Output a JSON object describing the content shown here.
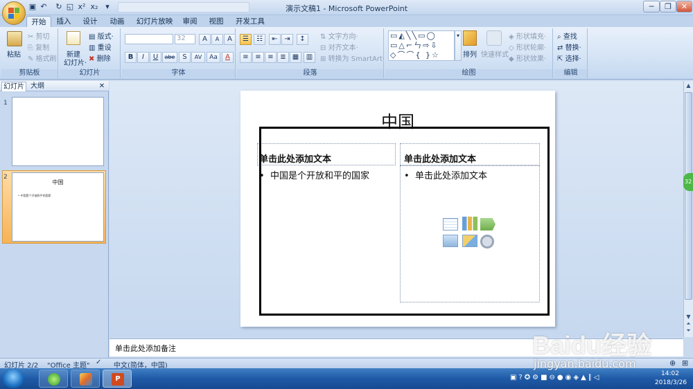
{
  "window": {
    "title": "演示文稿1 - Microsoft PowerPoint",
    "minimize": "─",
    "restore": "❐",
    "close": "✕"
  },
  "qat": {
    "save": "▣",
    "undo": "↶",
    "redo": "↻",
    "preview": "◱",
    "superscript": "x²",
    "subscript": "x₂",
    "more": "▾"
  },
  "tabs": [
    "开始",
    "插入",
    "设计",
    "动画",
    "幻灯片放映",
    "审阅",
    "视图",
    "开发工具"
  ],
  "ribbon": {
    "clipboard": {
      "label": "剪贴板",
      "paste": "粘贴",
      "cut": "剪切",
      "copy": "复制",
      "format_painter": "格式刷"
    },
    "slides": {
      "label": "幻灯片",
      "new_slide": "新建",
      "new_slide2": "幻灯片·",
      "layout": "版式·",
      "reset": "重设",
      "delete": "删除"
    },
    "font": {
      "label": "字体",
      "size": "32",
      "bold": "B",
      "italic": "I",
      "underline": "U",
      "strike": "abe",
      "shadow": "S",
      "spacing": "AV",
      "case": "Aa",
      "grow": "A",
      "shrink": "A",
      "clear": "A"
    },
    "paragraph": {
      "label": "段落",
      "text_direction": "文字方向·",
      "align_text": "对齐文本·",
      "smartart": "转换为 SmartArt·"
    },
    "drawing": {
      "label": "绘图",
      "arrange": "排列",
      "quick_styles": "快速样式",
      "fill": "形状填充·",
      "outline": "形状轮廓·",
      "effects": "形状效果·"
    },
    "editing": {
      "label": "编辑",
      "find": "查找",
      "replace": "替换·",
      "select": "选择·"
    }
  },
  "panel": {
    "tab_slides": "幻灯片",
    "tab_outline": "大纲",
    "close": "✕"
  },
  "thumbnails": [
    {
      "number": "1",
      "title": "",
      "bullet": ""
    },
    {
      "number": "2",
      "title": "中国",
      "bullet": "中国是个开放和平的国家"
    }
  ],
  "slide": {
    "title": "中国",
    "left_heading": "单击此处添加文本",
    "left_bullet": "中国是个开放和平的国家",
    "right_heading": "单击此处添加文本",
    "right_bullet": "单击此处添加文本"
  },
  "notes": {
    "placeholder": "单击此处添加备注"
  },
  "status": {
    "slide_count": "幻灯片 2/2",
    "theme": "\"Office 主题\"",
    "language": "中文(简体，中国)",
    "zoom_badge": "32"
  },
  "watermark": {
    "line1": "Baidu经验",
    "line2": "jingyan.baidu.com"
  },
  "taskbar": {
    "time": "14:02",
    "date": "2018/3/26"
  },
  "colors": {
    "accent": "#d04a1f",
    "ribbon": "#d4e3f5",
    "taskbar": "#1f5aa7"
  }
}
